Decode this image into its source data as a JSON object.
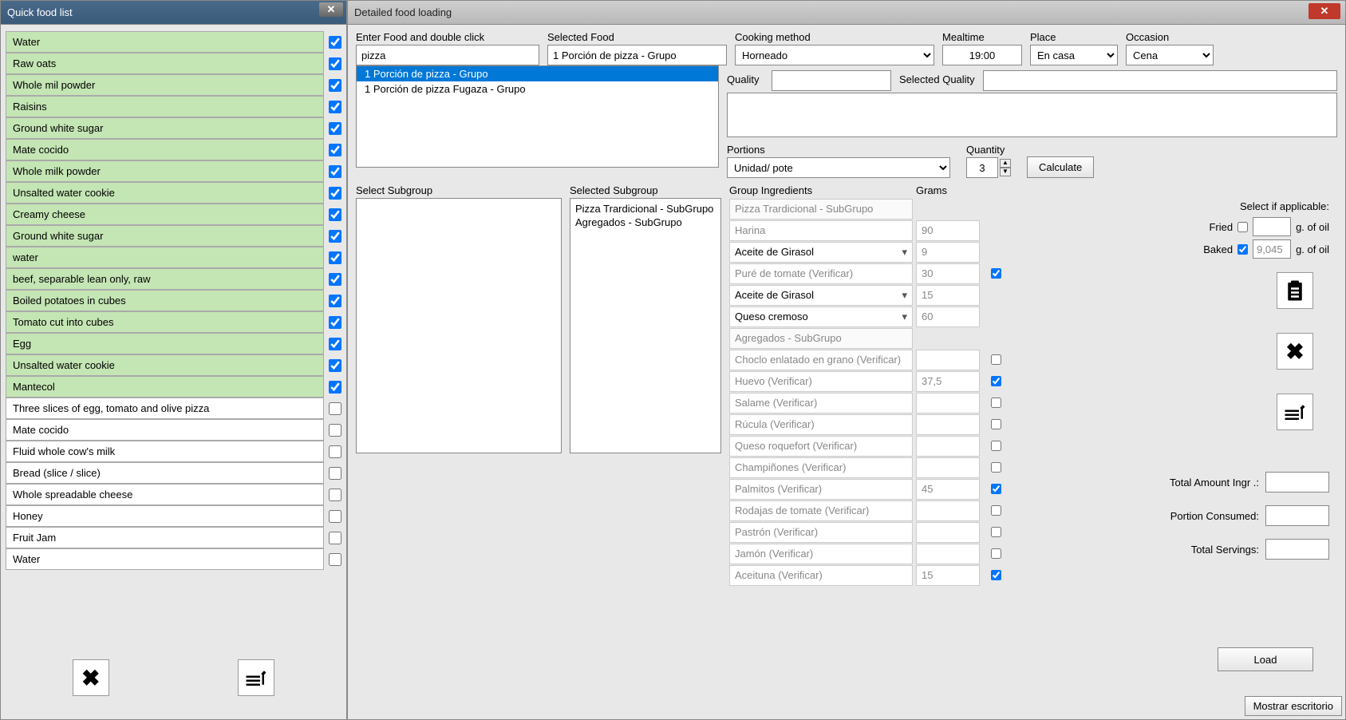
{
  "left": {
    "title": "Quick food list",
    "items": [
      {
        "name": "Water",
        "checked": true,
        "green": true
      },
      {
        "name": "Raw oats",
        "checked": true,
        "green": true
      },
      {
        "name": "Whole mil powder",
        "checked": true,
        "green": true
      },
      {
        "name": "Raisins",
        "checked": true,
        "green": true
      },
      {
        "name": "Ground white sugar",
        "checked": true,
        "green": true
      },
      {
        "name": "Mate cocido",
        "checked": true,
        "green": true
      },
      {
        "name": "Whole milk powder",
        "checked": true,
        "green": true
      },
      {
        "name": "Unsalted water cookie",
        "checked": true,
        "green": true
      },
      {
        "name": "Creamy cheese",
        "checked": true,
        "green": true
      },
      {
        "name": "Ground white sugar",
        "checked": true,
        "green": true
      },
      {
        "name": "water",
        "checked": true,
        "green": true
      },
      {
        "name": "beef, separable lean only, raw",
        "checked": true,
        "green": true
      },
      {
        "name": "Boiled potatoes in cubes",
        "checked": true,
        "green": true
      },
      {
        "name": "Tomato cut into cubes",
        "checked": true,
        "green": true
      },
      {
        "name": "Egg",
        "checked": true,
        "green": true
      },
      {
        "name": "Unsalted water cookie",
        "checked": true,
        "green": true
      },
      {
        "name": "Mantecol",
        "checked": true,
        "green": true
      },
      {
        "name": "Three slices of egg, tomato and olive pizza",
        "checked": false,
        "green": false
      },
      {
        "name": "Mate cocido",
        "checked": false,
        "green": false
      },
      {
        "name": "Fluid whole cow's milk",
        "checked": false,
        "green": false
      },
      {
        "name": "Bread (slice / slice)",
        "checked": false,
        "green": false
      },
      {
        "name": "Whole spreadable cheese",
        "checked": false,
        "green": false
      },
      {
        "name": "Honey",
        "checked": false,
        "green": false
      },
      {
        "name": "Fruit Jam",
        "checked": false,
        "green": false
      },
      {
        "name": "Water",
        "checked": false,
        "green": false
      }
    ]
  },
  "right": {
    "title": "Detailed food loading",
    "labels": {
      "enterFood": "Enter Food and double click",
      "selectedFood": "Selected Food",
      "cooking": "Cooking method",
      "mealtime": "Mealtime",
      "place": "Place",
      "occasion": "Occasion",
      "quality": "Quality",
      "selQuality": "Selected Quality",
      "portions": "Portions",
      "quantity": "Quantity",
      "calculate": "Calculate",
      "selectSub": "Select Subgroup",
      "selectedSub": "Selected Subgroup",
      "groupIng": "Group Ingredients",
      "grams": "Grams",
      "selectApplicable": "Select if applicable:",
      "fried": "Fried",
      "baked": "Baked",
      "ofOil": "g. of oil",
      "totalAmount": "Total Amount Ingr .:",
      "portionConsumed": "Portion Consumed:",
      "totalServings": "Total Servings:",
      "load": "Load",
      "taskbar": "Mostrar escritorio"
    },
    "values": {
      "searchInput": "pizza",
      "selectedFood": "1 Porción de pizza - Grupo",
      "cooking": "Horneado",
      "mealtime": "19:00",
      "place": "En casa",
      "occasion": "Cena",
      "portions": "Unidad/ pote",
      "quantity": "3",
      "bakedOil": "9,045",
      "bakedChecked": true,
      "friedChecked": false
    },
    "searchResults": [
      {
        "text": "1 Porción de pizza - Grupo",
        "selected": true
      },
      {
        "text": "1 Porción de pizza Fugaza - Grupo",
        "selected": false
      }
    ],
    "selectedSubgroups": [
      "Pizza Trardicional - SubGrupo",
      "Agregados - SubGrupo"
    ],
    "ingredients": [
      {
        "name": "Pizza Trardicional - SubGrupo",
        "grams": "",
        "type": "sub",
        "chk": null
      },
      {
        "name": "Harina",
        "grams": "90",
        "type": "plain",
        "chk": null
      },
      {
        "name": "Aceite de Girasol",
        "grams": "9",
        "type": "dd",
        "chk": null
      },
      {
        "name": "Puré de tomate (Verificar)",
        "grams": "30",
        "type": "plain",
        "chk": true
      },
      {
        "name": "Aceite de Girasol",
        "grams": "15",
        "type": "dd",
        "chk": null
      },
      {
        "name": "Queso cremoso",
        "grams": "60",
        "type": "dd",
        "chk": null
      },
      {
        "name": "Agregados - SubGrupo",
        "grams": "",
        "type": "sub",
        "chk": null
      },
      {
        "name": "Choclo enlatado en grano (Verificar)",
        "grams": "",
        "type": "plain",
        "chk": false
      },
      {
        "name": "Huevo (Verificar)",
        "grams": "37,5",
        "type": "plain",
        "chk": true
      },
      {
        "name": "Salame (Verificar)",
        "grams": "",
        "type": "plain",
        "chk": false
      },
      {
        "name": "Rúcula (Verificar)",
        "grams": "",
        "type": "plain",
        "chk": false
      },
      {
        "name": "Queso roquefort (Verificar)",
        "grams": "",
        "type": "plain",
        "chk": false
      },
      {
        "name": "Champiñones (Verificar)",
        "grams": "",
        "type": "plain",
        "chk": false
      },
      {
        "name": "Palmitos (Verificar)",
        "grams": "45",
        "type": "plain",
        "chk": true
      },
      {
        "name": "Rodajas de tomate (Verificar)",
        "grams": "",
        "type": "plain",
        "chk": false
      },
      {
        "name": "Pastrón (Verificar)",
        "grams": "",
        "type": "plain",
        "chk": false
      },
      {
        "name": "Jamón (Verificar)",
        "grams": "",
        "type": "plain",
        "chk": false
      },
      {
        "name": "Aceituna (Verificar)",
        "grams": "15",
        "type": "plain",
        "chk": true
      }
    ]
  }
}
